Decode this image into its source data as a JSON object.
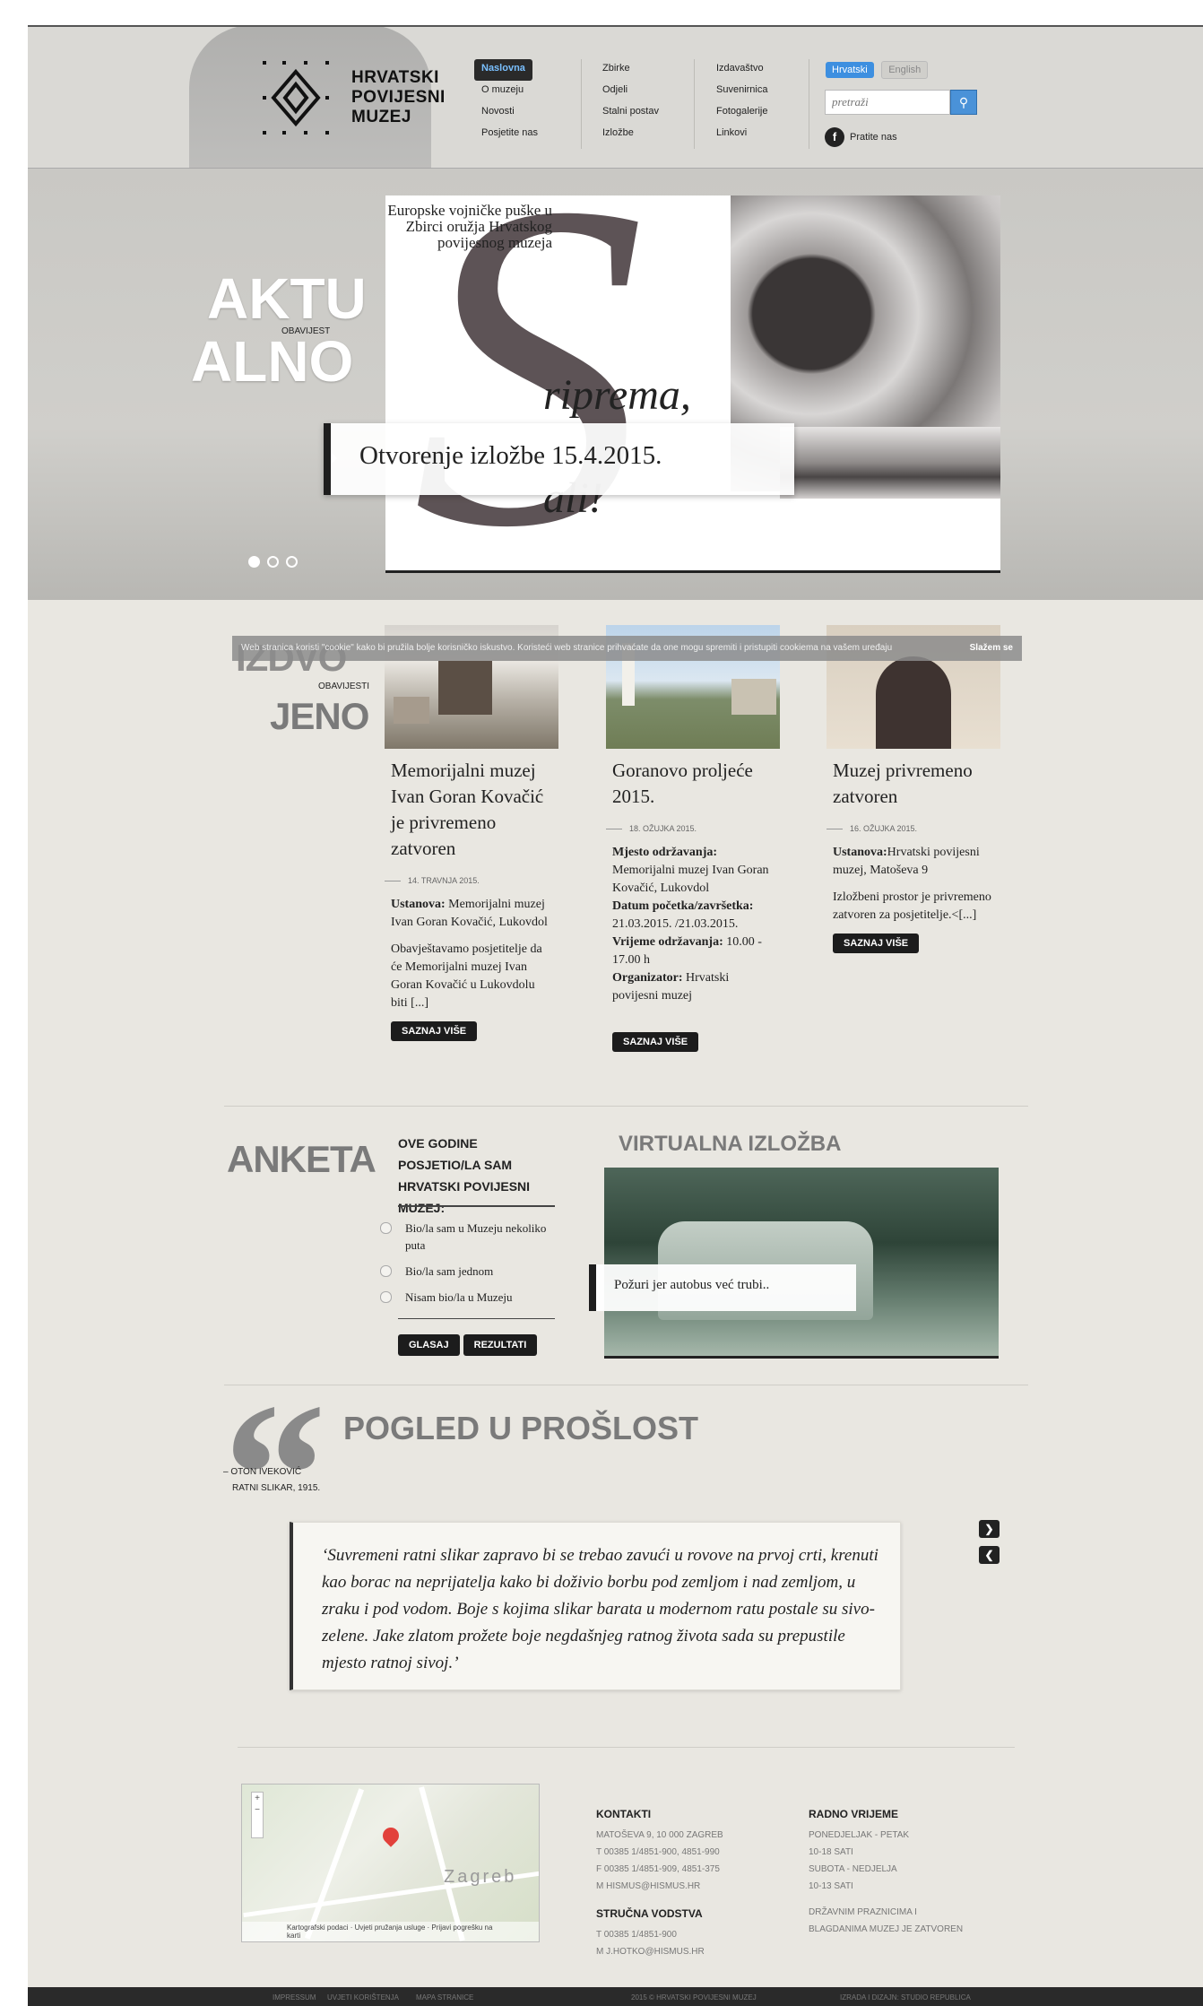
{
  "header": {
    "logo_lines": [
      "HRVATSKI",
      "POVIJESNI",
      "MUZEJ"
    ],
    "nav": [
      [
        "Naslovna",
        "O muzeju",
        "Novosti",
        "Posjetite nas"
      ],
      [
        "Zbirke",
        "Odjeli",
        "Stalni postav",
        "Izložbe"
      ],
      [
        "Izdavaštvo",
        "Suvenirnica",
        "Fotogalerije",
        "Linkovi"
      ]
    ],
    "lang_hr": "Hrvatski",
    "lang_en": "English",
    "search_placeholder": "pretraži",
    "follow": "Pratite nas"
  },
  "hero": {
    "label_line1": "AKTU",
    "label_line2": "ALNO",
    "sub": "OBAVIJEST",
    "slide_title": "Europske vojničke puške u Zbirci oružja Hrvatskog povijesnog muzeja",
    "priprema": "riprema,",
    "pali": "ali!",
    "caption": "Otvorenje izložbe 15.4.2015."
  },
  "cookie": {
    "text": "Web stranica koristi \"cookie\" kako bi pružila bolje korisničko iskustvo. Koristeći web stranice prihvaćate da one mogu spremiti i pristupiti cookiema na vašem uređaju",
    "ok": "Slažem se"
  },
  "izdvojeno": {
    "line1": "IZDVO",
    "line2": "JENO",
    "sub": "OBAVIJESTI",
    "more": "SAZNAJ VIŠE",
    "cards": [
      {
        "title": "Memorijalni muzej Ivan Goran Kovačić je privremeno zatvoren",
        "date": "14. TRAVNJA 2015.",
        "p1_label": "Ustanova:",
        "p1_value": " Memorijalni muzej Ivan Goran Kovačić, Lukovdol",
        "p2": "Obavještavamo posjetitelje da će Memorijalni muzej Ivan Goran Kovačić u Lukovdolu biti [...]"
      },
      {
        "title": "Goranovo proljeće 2015.",
        "date": "18. OŽUJKA 2015.",
        "place_label": "Mjesto održavanja:",
        "place_value": " Memorijalni muzej Ivan Goran Kovačić, Lukovdol",
        "date_label": "Datum početka/završetka:",
        "date_value": " 21.03.2015. /21.03.2015.",
        "time_label": "Vrijeme održavanja:",
        "time_value": " 10.00 - 17.00 h",
        "org_label": "Organizator:",
        "org_value": " Hrvatski povijesni muzej"
      },
      {
        "title": "Muzej privremeno zatvoren",
        "date": "16. OŽUJKA 2015.",
        "p1_label": "Ustanova:",
        "p1_value": "Hrvatski povijesni muzej, Matoševa 9",
        "p2": "Izložbeni prostor je privremeno zatvoren za posjetitelje.<[...]"
      }
    ]
  },
  "anketa": {
    "label": "ANKETA",
    "question": "OVE GODINE POSJETIO/LA SAM HRVATSKI POVIJESNI MUZEJ:",
    "options": [
      "Bio/la sam u Muzeju nekoliko puta",
      "Bio/la sam jednom",
      "Nisam bio/la u Muzeju"
    ],
    "vote": "GLASAJ",
    "results": "REZULTATI"
  },
  "virtualna": {
    "label": "VIRTUALNA IZLOŽBA",
    "caption": "Požuri jer autobus već trubi.."
  },
  "pogled": {
    "label": "POGLED U PROŠLOST",
    "author": "– OTON IVEKOVIĆ",
    "author_role": "RATNI SLIKAR, 1915.",
    "quote": "‘Suvremeni ratni slikar zapravo bi se trebao zavući u rovove na prvoj crti, krenuti kao borac na neprijatelja kako bi doživio borbu pod zemljom i nad zemljom, u zraku i pod vodom. Boje s kojima slikar barata u modernom ratu postale su sivo-zelene. Jake zlatom prožete boje negdašnjeg ratnog života sada su prepustile mjesto ratnoj sivoj.’"
  },
  "footer": {
    "map_city": "Zagreb",
    "map_credits": "Kartografski podaci · Uvjeti pružanja usluge · Prijavi pogrešku na karti",
    "kontakti_title": "KONTAKTI",
    "kontakti": [
      "MATOŠEVA 9, 10 000 ZAGREB",
      "T 00385 1/4851-900, 4851-990",
      "F 00385 1/4851-909, 4851-375",
      "M HISMUS@HISMUS.HR"
    ],
    "strucna_title": "STRUČNA VODSTVA",
    "strucna": [
      "T 00385 1/4851-900",
      "M J.HOTKO@HISMUS.HR"
    ],
    "radno_title": "RADNO VRIJEME",
    "radno": [
      "PONEDJELJAK - PETAK",
      "10-18 SATI",
      "SUBOTA - NEDJELJA",
      "10-13 SATI"
    ],
    "praznici": [
      "DRŽAVNIM PRAZNICIMA I",
      "BLAGDANIMA MUZEJ JE ZATVOREN"
    ],
    "bottom_links": [
      "IMPRESSUM",
      "UVJETI KORIŠTENJA",
      "MAPA STRANICE"
    ],
    "copyright": "2015 © HRVATSKI POVIJESNI MUZEJ",
    "credit": "IZRADA I DIZAJN: STUDIO REPUBLICA"
  }
}
